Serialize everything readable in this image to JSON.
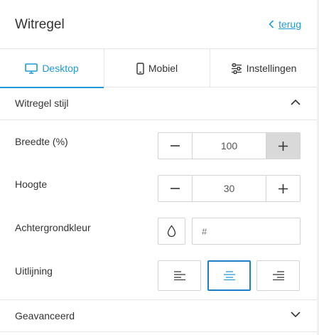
{
  "header": {
    "title": "Witregel",
    "back_label": "terug"
  },
  "tabs": [
    {
      "label": "Desktop",
      "icon": "desktop-icon",
      "active": true
    },
    {
      "label": "Mobiel",
      "icon": "mobile-icon",
      "active": false
    },
    {
      "label": "Instellingen",
      "icon": "sliders-icon",
      "active": false
    }
  ],
  "style_section": {
    "title": "Witregel stijl",
    "expanded": true,
    "width": {
      "label": "Breedte (%)",
      "value": "100"
    },
    "height": {
      "label": "Hoogte",
      "value": "30"
    },
    "background": {
      "label": "Achtergrondkleur",
      "placeholder": "#",
      "value": ""
    },
    "alignment": {
      "label": "Uitlijning",
      "options": [
        "left",
        "center",
        "right"
      ],
      "selected": "center"
    }
  },
  "advanced_section": {
    "title": "Geavanceerd",
    "expanded": false
  },
  "colors": {
    "accent": "#1e9bd7",
    "active_border": "#1e7ec8",
    "border": "#d4d4d4"
  }
}
